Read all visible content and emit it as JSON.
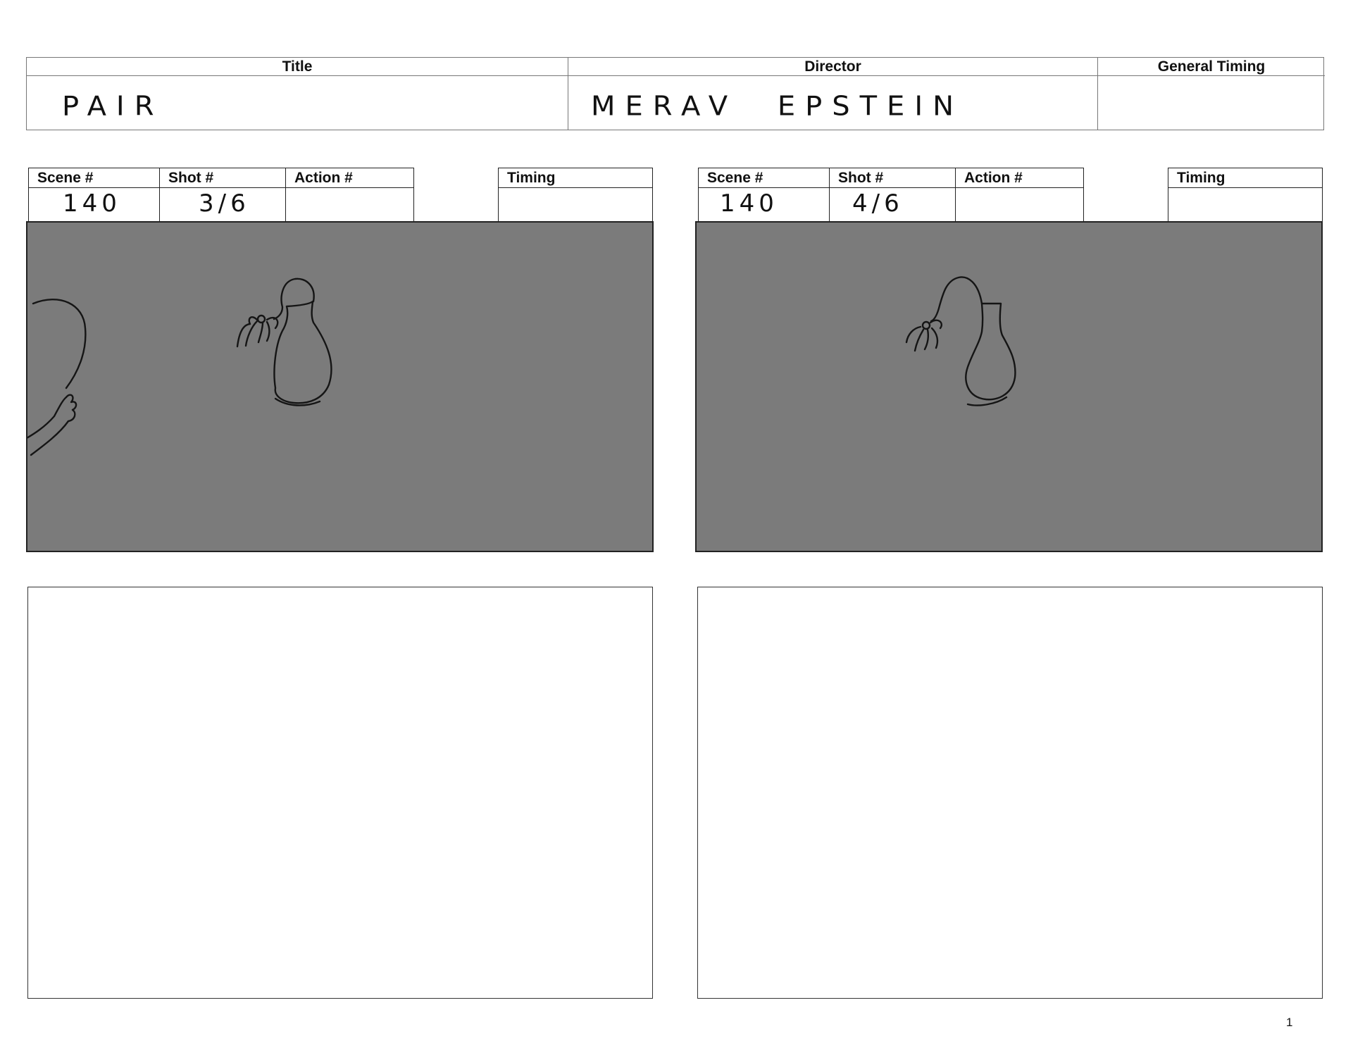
{
  "header": {
    "title_label": "Title",
    "title_value": "PAIR",
    "director_label": "Director",
    "director_value": "MERAV EPSTEIN",
    "timing_label": "General Timing",
    "timing_value": ""
  },
  "panels": [
    {
      "scene_label": "Scene #",
      "scene_value": "140",
      "shot_label": "Shot #",
      "shot_value": "3/6",
      "action_label": "Action #",
      "action_value": "",
      "timing_label": "Timing",
      "timing_value": ""
    },
    {
      "scene_label": "Scene #",
      "scene_value": "140",
      "shot_label": "Shot #",
      "shot_value": "4/6",
      "action_label": "Action #",
      "action_value": "",
      "timing_label": "Timing",
      "timing_value": ""
    }
  ],
  "page_number": "1"
}
